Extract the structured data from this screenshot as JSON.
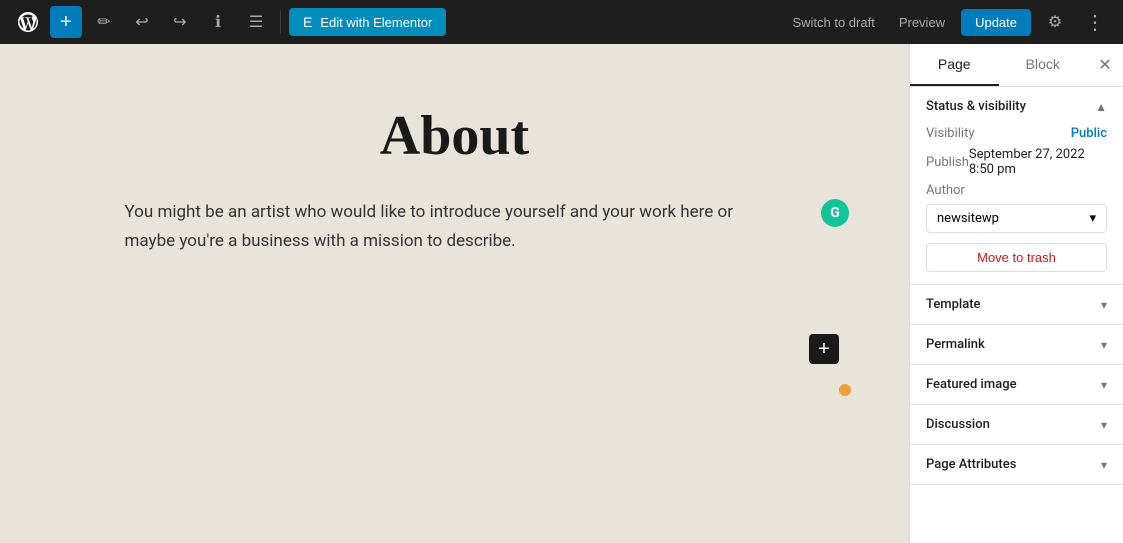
{
  "toolbar": {
    "add_label": "+",
    "edit_icon": "✏",
    "undo_icon": "↩",
    "redo_icon": "↪",
    "info_icon": "ℹ",
    "list_icon": "☰",
    "elementor_label": "Edit with Elementor",
    "elementor_icon": "E",
    "switch_draft_label": "Switch to draft",
    "preview_label": "Preview",
    "update_label": "Update",
    "settings_icon": "⚙",
    "more_icon": "⋮"
  },
  "canvas": {
    "page_title": "About",
    "page_body": "You might be an artist who would like to introduce yourself and your work here or maybe you're a business with a mission to describe.",
    "add_block_icon": "+",
    "grammarly_letter": "G"
  },
  "sidebar": {
    "tab_page": "Page",
    "tab_block": "Block",
    "close_icon": "✕",
    "sections": {
      "status_visibility": {
        "title": "Status & visibility",
        "visibility_label": "Visibility",
        "visibility_value": "Public",
        "publish_label": "Publish",
        "publish_value": "September 27, 2022 8:50 pm",
        "author_label": "Author",
        "author_value": "newsitewp",
        "move_trash_label": "Move to trash"
      },
      "template": {
        "title": "Template"
      },
      "permalink": {
        "title": "Permalink"
      },
      "featured_image": {
        "title": "Featured image"
      },
      "discussion": {
        "title": "Discussion"
      },
      "page_attributes": {
        "title": "Page Attributes"
      }
    }
  }
}
